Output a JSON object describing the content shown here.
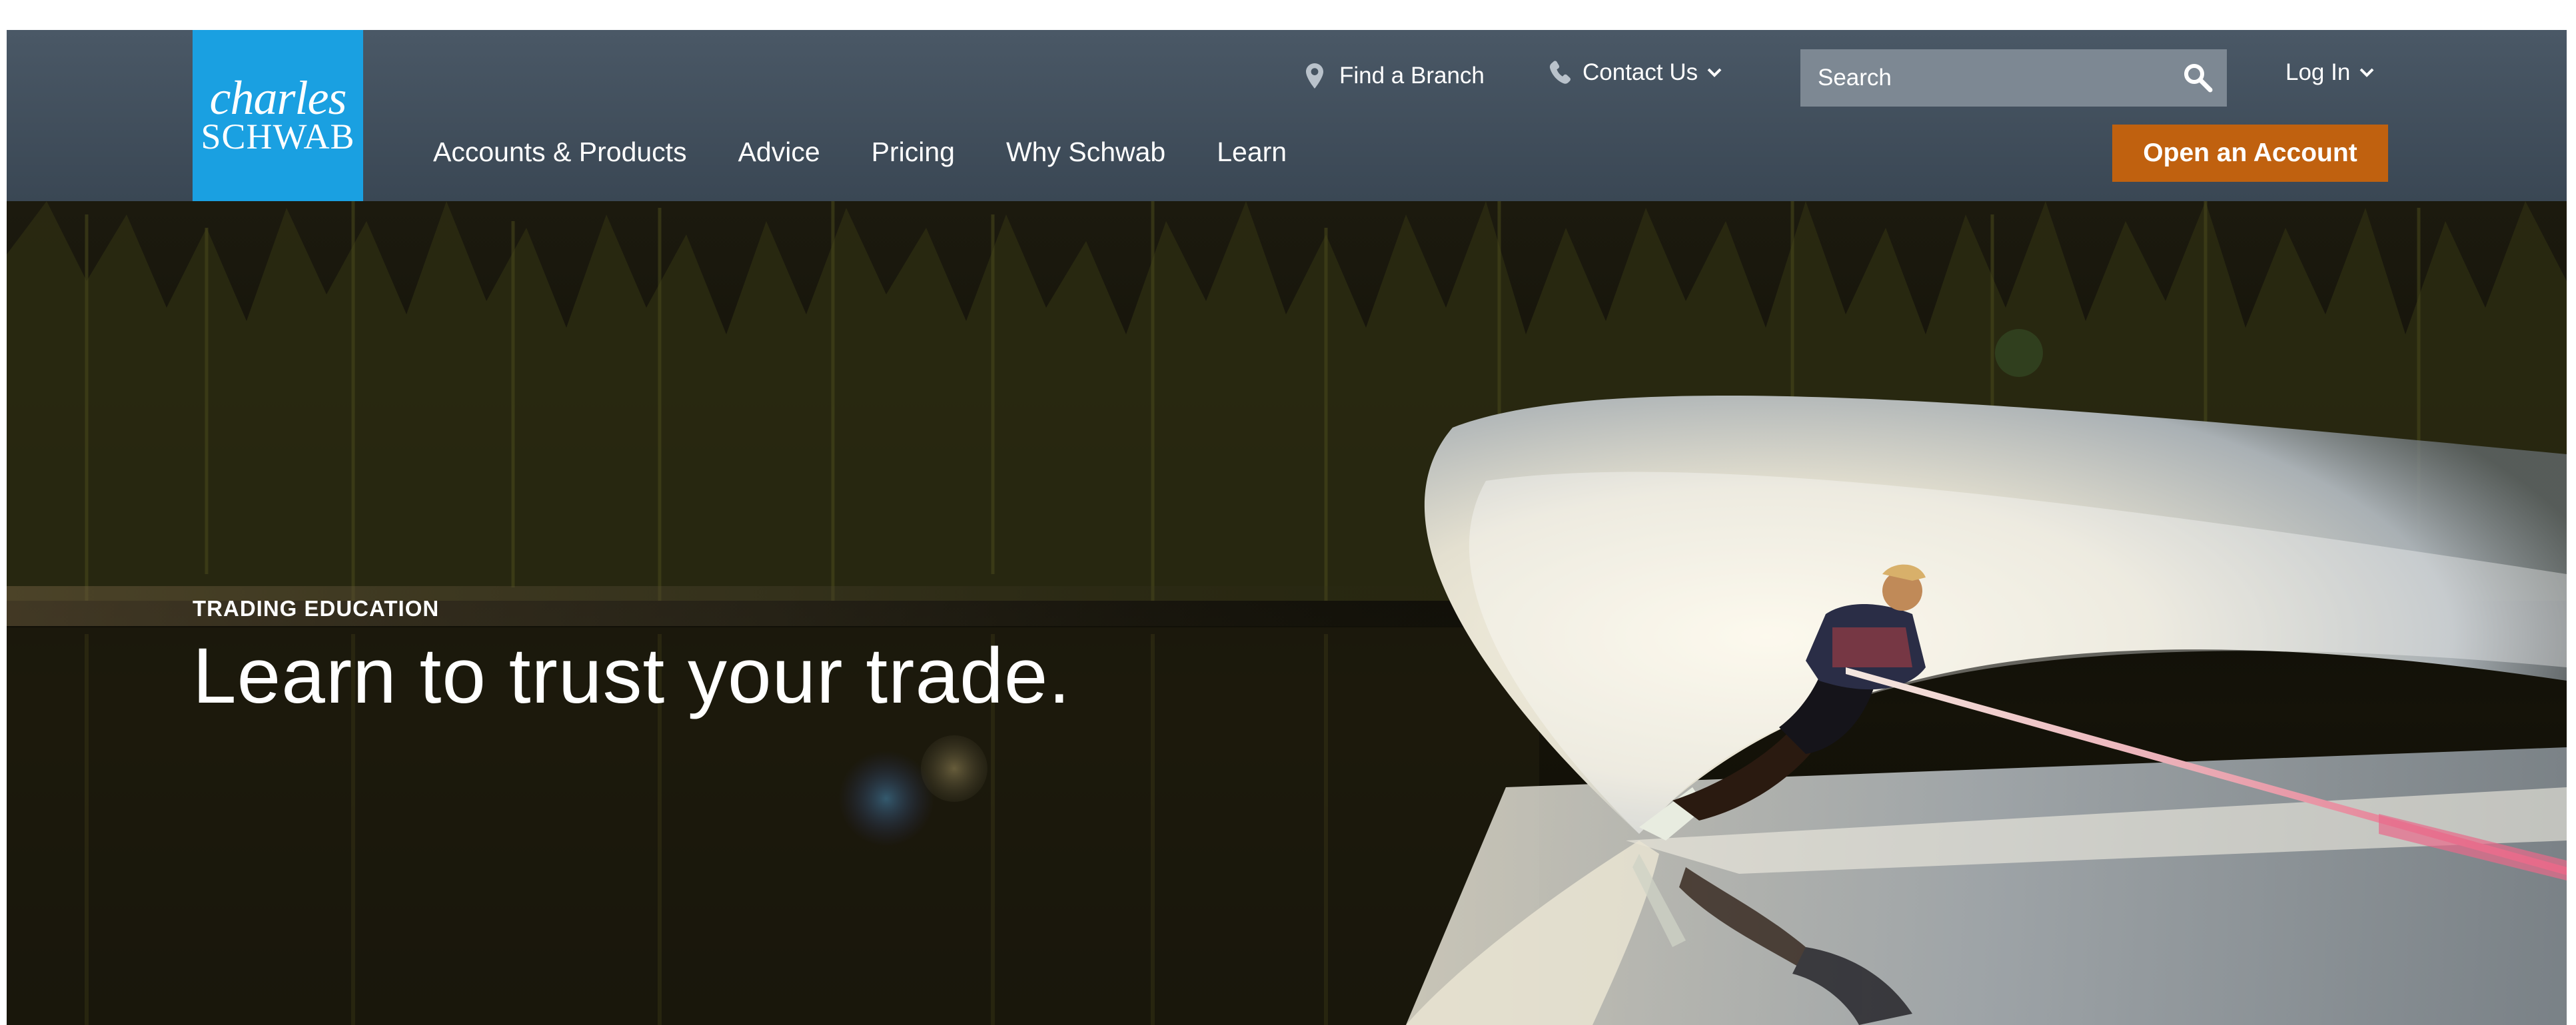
{
  "brand": {
    "logo_line1": "charles",
    "logo_line2": "SCHWAB",
    "logo_color": "#1aa0e1"
  },
  "utility_nav": {
    "find_branch": {
      "label": "Find a Branch",
      "icon": "map-pin-icon"
    },
    "contact_us": {
      "label": "Contact Us",
      "icon": "phone-icon"
    },
    "search": {
      "placeholder": "Search",
      "value": "",
      "icon": "search-icon"
    },
    "log_in": {
      "label": "Log In"
    }
  },
  "main_nav": {
    "items": [
      {
        "label": "Accounts & Products"
      },
      {
        "label": "Advice"
      },
      {
        "label": "Pricing"
      },
      {
        "label": "Why Schwab"
      },
      {
        "label": "Learn"
      }
    ],
    "cta_label": "Open an Account",
    "cta_color": "#c0610f"
  },
  "hero": {
    "eyebrow": "TRADING EDUCATION",
    "headline": "Learn to trust your trade.",
    "image_subject": "water skier carving spray on a lake at dusk"
  },
  "colors": {
    "header_bg": "#414f5c",
    "search_bg": "#7d8893"
  }
}
